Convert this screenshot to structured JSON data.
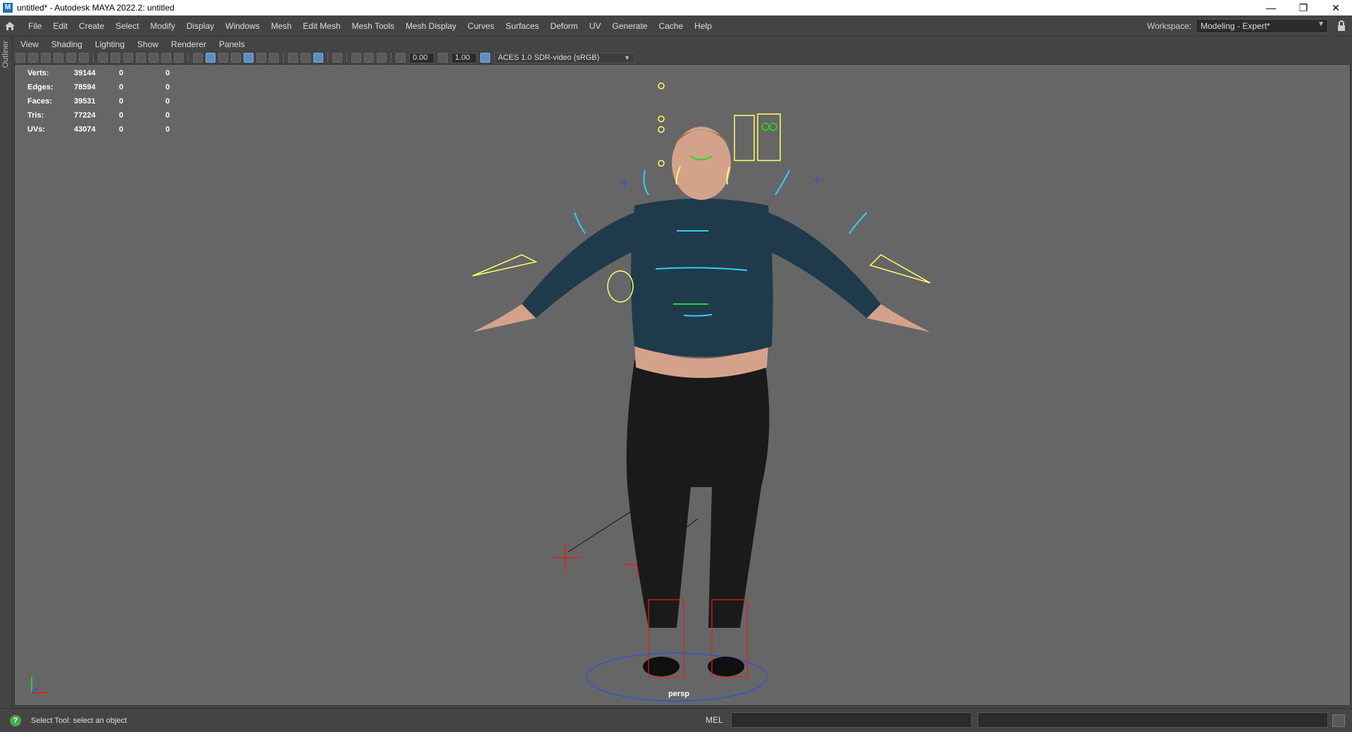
{
  "window": {
    "title": "untitled* - Autodesk MAYA 2022.2: untitled",
    "app_icon_letter": "M",
    "minimize": "—",
    "restore": "❐",
    "close": "✕"
  },
  "menubar": {
    "items": [
      "File",
      "Edit",
      "Create",
      "Select",
      "Modify",
      "Display",
      "Windows",
      "Mesh",
      "Edit Mesh",
      "Mesh Tools",
      "Mesh Display",
      "Curves",
      "Surfaces",
      "Deform",
      "UV",
      "Generate",
      "Cache",
      "Help"
    ],
    "workspace_label": "Workspace:",
    "workspace_value": "Modeling - Expert*",
    "chevron": "▼"
  },
  "left_strip": {
    "label": "Outliner"
  },
  "panel_menu": {
    "items": [
      "View",
      "Shading",
      "Lighting",
      "Show",
      "Renderer",
      "Panels"
    ]
  },
  "toolbar": {
    "near_clip": "0.00",
    "far_clip": "1.00",
    "color_space": "ACES 1.0 SDR-video (sRGB)",
    "chevron": "▼"
  },
  "hud": {
    "rows": [
      {
        "label": "Verts:",
        "v1": "39144",
        "v2": "0",
        "v3": "0"
      },
      {
        "label": "Edges:",
        "v1": "78594",
        "v2": "0",
        "v3": "0"
      },
      {
        "label": "Faces:",
        "v1": "39531",
        "v2": "0",
        "v3": "0"
      },
      {
        "label": "Tris:",
        "v1": "77224",
        "v2": "0",
        "v3": "0"
      },
      {
        "label": "UVs:",
        "v1": "43074",
        "v2": "0",
        "v3": "0"
      }
    ]
  },
  "viewport": {
    "camera": "persp",
    "colors": {
      "background": "#666666",
      "sweater": "#1f3a4a",
      "pants": "#1a1a1a",
      "skin": "#d9a890",
      "control_yellow": "#ffff66",
      "control_cyan": "#33ccff",
      "control_red": "#e02020",
      "control_green": "#22dd22"
    }
  },
  "status": {
    "icon": "?",
    "message": "Select Tool: select an object",
    "mel_label": "MEL"
  }
}
